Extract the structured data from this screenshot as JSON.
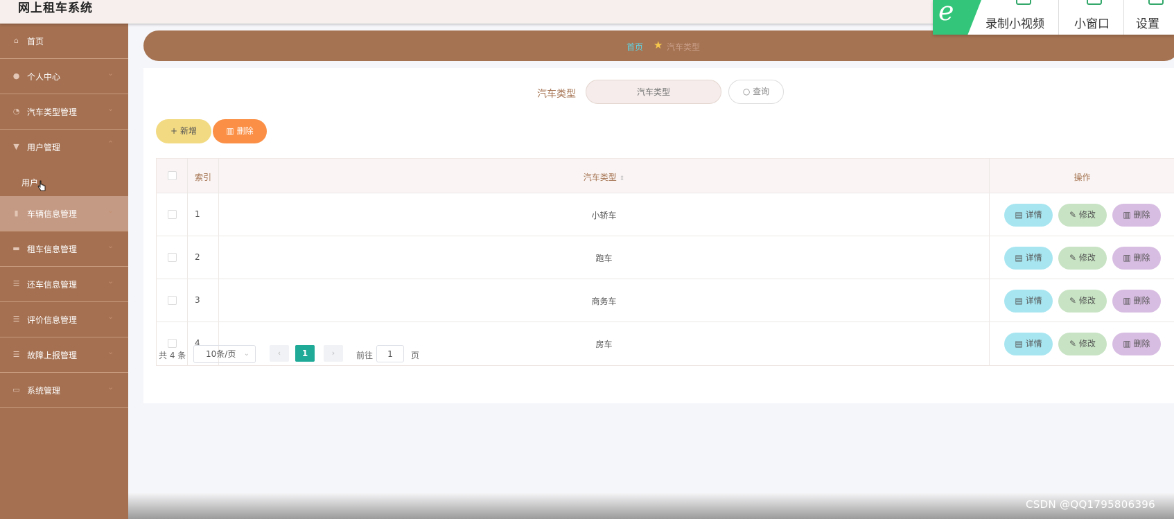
{
  "app": {
    "title": "网上租车系统"
  },
  "recorder": {
    "logo": "e",
    "items": [
      "录制小视频",
      "小窗口",
      "设置"
    ]
  },
  "sidebar": {
    "items": [
      {
        "label": "首页",
        "icon": "home-icon"
      },
      {
        "label": "个人中心",
        "icon": "user-icon"
      },
      {
        "label": "汽车类型管理",
        "icon": "gauge-icon"
      },
      {
        "label": "用户管理",
        "icon": "flag-icon",
        "expanded": true
      },
      {
        "label": "车辆信息管理",
        "icon": "bar-chart-icon"
      },
      {
        "label": "租车信息管理",
        "icon": "cart-icon"
      },
      {
        "label": "还车信息管理",
        "icon": "list-icon"
      },
      {
        "label": "评价信息管理",
        "icon": "list-icon"
      },
      {
        "label": "故障上报管理",
        "icon": "sliders-icon"
      },
      {
        "label": "系统管理",
        "icon": "monitor-icon"
      }
    ],
    "submenu": {
      "label": "用户"
    }
  },
  "breadcrumb": {
    "home": "首页",
    "current": "汽车类型"
  },
  "search": {
    "label": "汽车类型",
    "placeholder": "汽车类型",
    "button": "查询"
  },
  "actions": {
    "add": "新增",
    "delete": "删除"
  },
  "table": {
    "headers": {
      "index": "索引",
      "type": "汽车类型",
      "ops": "操作"
    },
    "rows": [
      {
        "index": "1",
        "type": "小轿车"
      },
      {
        "index": "2",
        "type": "跑车"
      },
      {
        "index": "3",
        "type": "商务车"
      },
      {
        "index": "4",
        "type": "房车"
      }
    ],
    "row_actions": {
      "detail": "详情",
      "edit": "修改",
      "delete": "删除"
    }
  },
  "pagination": {
    "total": "共 4 条",
    "page_size": "10条/页",
    "current": "1",
    "goto_label": "前往",
    "goto_value": "1",
    "page_suffix": "页"
  },
  "watermark": "CSDN @QQ1795806396",
  "colors": {
    "sidebar": "#a47051",
    "breadcrumb": "#a57352",
    "accent_home": "#60d3e4",
    "pager_active": "#1fa997",
    "add": "#f2da82",
    "delete": "#fb8f45"
  }
}
